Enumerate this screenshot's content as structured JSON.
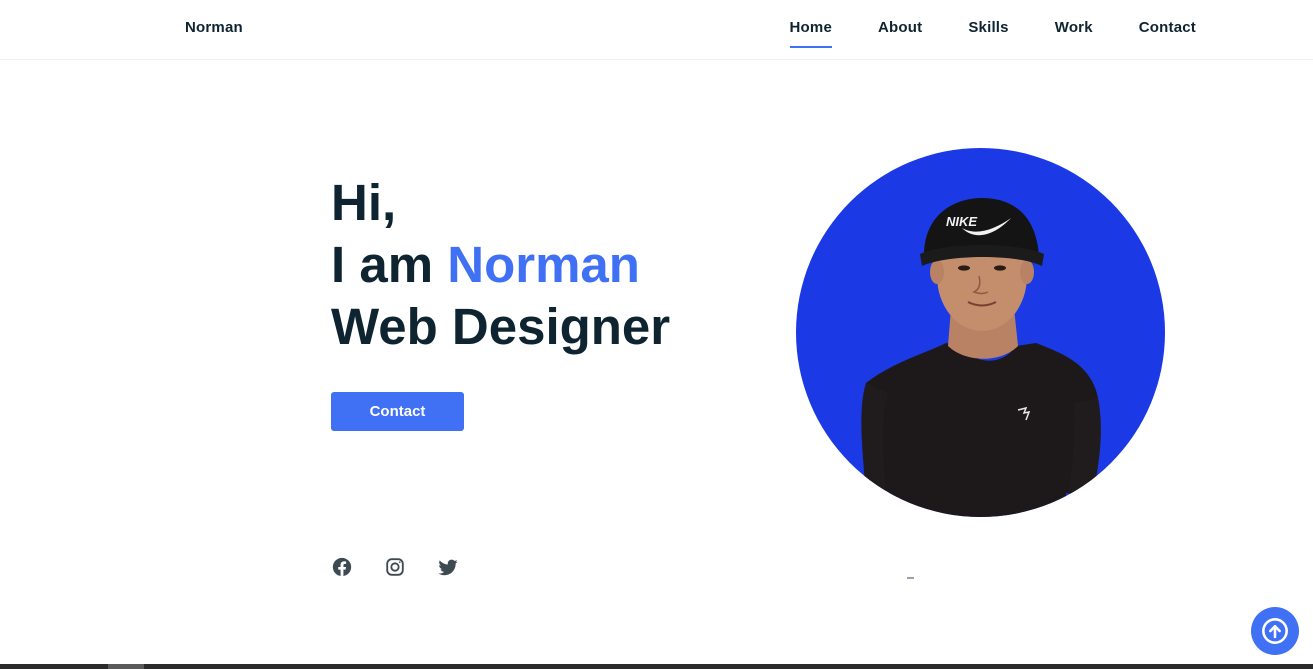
{
  "header": {
    "logo": "Norman",
    "nav": [
      {
        "label": "Home",
        "active": true
      },
      {
        "label": "About",
        "active": false
      },
      {
        "label": "Skills",
        "active": false
      },
      {
        "label": "Work",
        "active": false
      },
      {
        "label": "Contact",
        "active": false
      }
    ]
  },
  "hero": {
    "greeting": "Hi,",
    "intro": "I am ",
    "name": "Norman",
    "role": "Web Designer",
    "cta_label": "Contact",
    "socials": [
      {
        "icon": "facebook-icon"
      },
      {
        "icon": "instagram-icon"
      },
      {
        "icon": "twitter-icon"
      }
    ],
    "avatar_icon": "portrait-photo",
    "cap_logo": "NIKE"
  },
  "colors": {
    "accent": "#4070f4",
    "text_dark": "#0e2431",
    "avatar_bg": "#1b3ae6"
  },
  "scroll_top_icon": "arrow-up-circle-icon"
}
